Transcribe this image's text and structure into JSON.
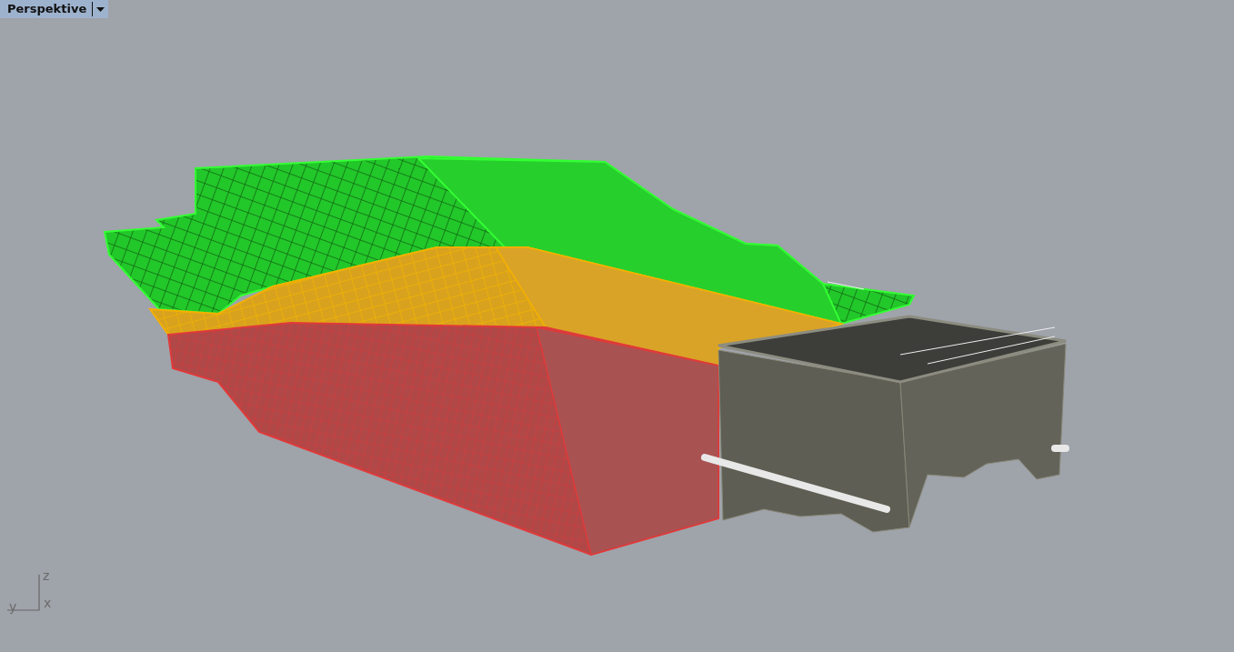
{
  "viewport": {
    "tab": {
      "label": "Perspektive",
      "selected": true
    }
  },
  "axes": {
    "z": "z",
    "x": "x",
    "y": "y"
  }
}
